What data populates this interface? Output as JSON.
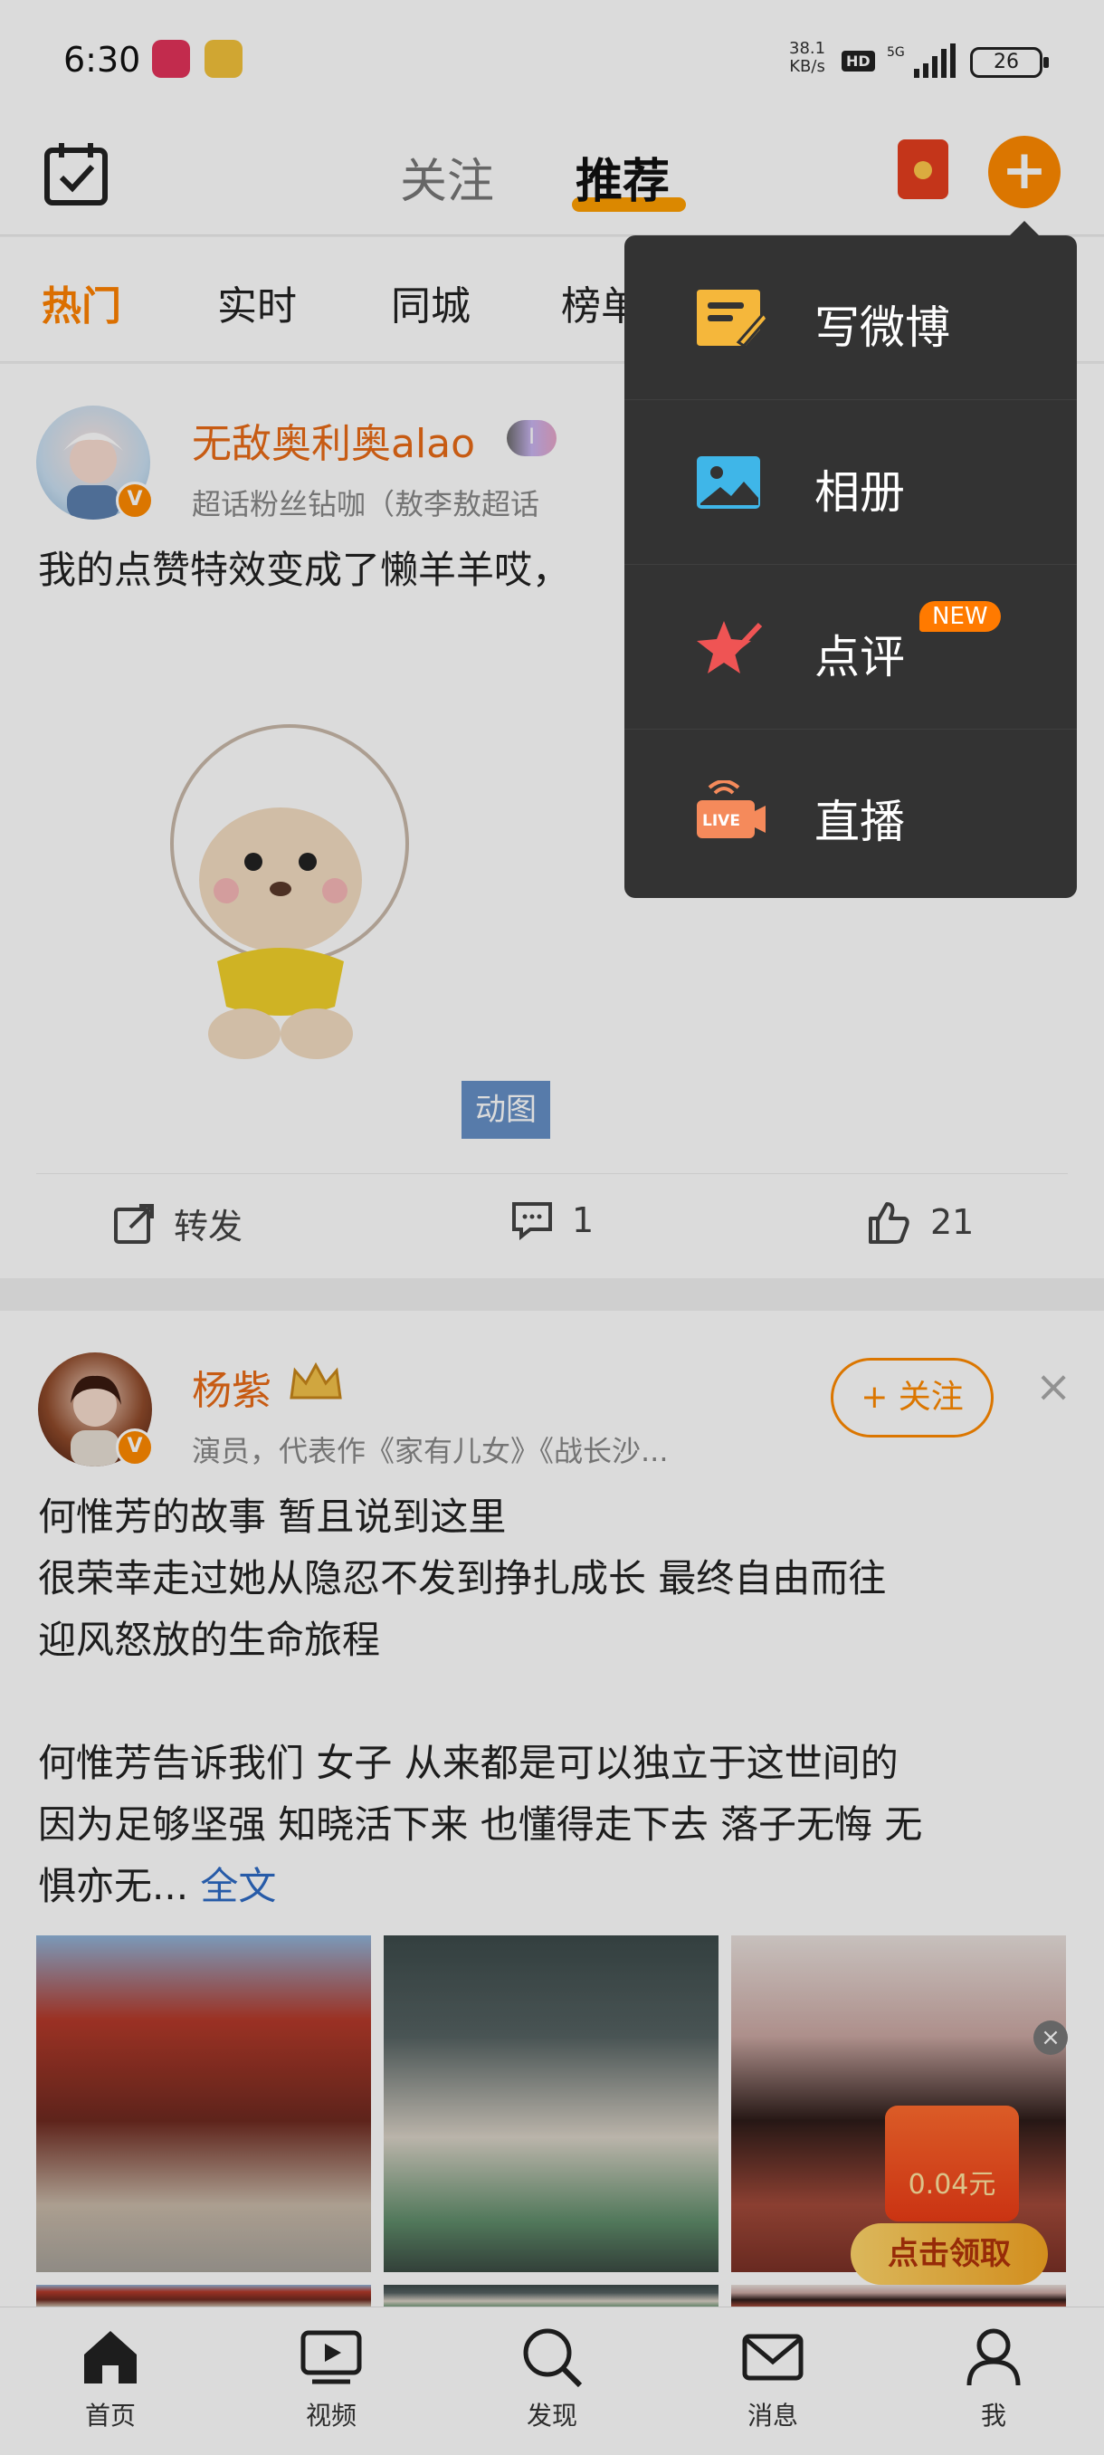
{
  "status_bar": {
    "time": "6:30",
    "net_speed_value": "38.1",
    "net_speed_unit": "KB/s",
    "hd": "HD",
    "network": "5G",
    "battery": "26"
  },
  "top_nav": {
    "follow": "关注",
    "recommended": "推荐",
    "plus": "+"
  },
  "sub_tabs": [
    "热门",
    "实时",
    "同城",
    "榜单"
  ],
  "post1": {
    "author": "无敌奥利奥alao",
    "verified": "V",
    "title_badge": "I",
    "subtitle": "超话粉丝钻咖（敖李敖超话",
    "text": "我的点赞特效变成了懒羊羊哎，",
    "gif_tag": "动图",
    "repost": "转发",
    "comments": "1",
    "likes": "21"
  },
  "post2": {
    "author": "杨紫",
    "verified": "V",
    "subtitle": "演员，代表作《家有儿女》《战长沙...",
    "follow_button": "+ 关注",
    "close": "×",
    "text": "何惟芳的故事 暂且说到这里\n很荣幸走过她从隐忍不发到挣扎成长 最终自由而往\n迎风怒放的生命旅程\n\n何惟芳告诉我们 女子 从来都是可以独立于这世间的\n因为足够坚强 知晓活下来 也懂得走下去 落子无悔 无\n惧亦无...",
    "read_more": "全文"
  },
  "red_packet": {
    "amount": "0.04元",
    "button": "点击领取",
    "close": "×"
  },
  "menu": {
    "items": [
      {
        "label": "写微博",
        "icon": "write-post-icon"
      },
      {
        "label": "相册",
        "icon": "album-icon"
      },
      {
        "label": "点评",
        "icon": "review-icon",
        "badge": "NEW"
      },
      {
        "label": "直播",
        "icon": "live-icon",
        "icon_text": "LIVE"
      }
    ]
  },
  "bottom_nav": [
    "首页",
    "视频",
    "发现",
    "消息",
    "我"
  ],
  "colors": {
    "accent": "#ff8a00",
    "link": "#2e6bc4",
    "menu_bg": "#333333"
  }
}
